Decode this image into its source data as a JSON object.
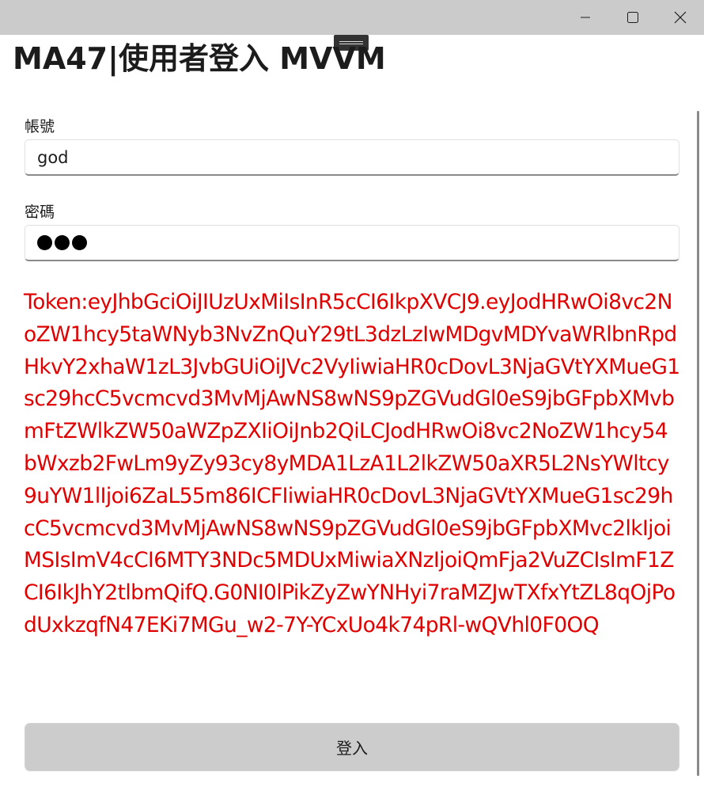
{
  "window": {
    "minimize_icon": "minimize-icon",
    "maximize_icon": "maximize-icon",
    "close_icon": "close-icon"
  },
  "page": {
    "title": "MA47|使用者登入 MVVM"
  },
  "form": {
    "username_label": "帳號",
    "username_value": "god",
    "password_label": "密碼",
    "password_mask_count": 3
  },
  "token": {
    "text": "Token:eyJhbGciOiJIUzUxMiIsInR5cCI6IkpXVCJ9.eyJodHRwOi8vc2NoZW1hcy5taWNyb3NvZnQuY29tL3dzLzIwMDgvMDYvaWRlbnRpdHkvY2xhaW1zL3JvbGUiOiJVc2VyIiwiaHR0cDovL3NjaGVtYXMueG1sc29hcC5vcmcvd3MvMjAwNS8wNS9pZGVudGl0eS9jbGFpbXMvbmFtZWlkZW50aWZpZXIiOiJnb2QiLCJodHRwOi8vc2NoZW1hcy54bWxzb2FwLm9yZy93cy8yMDA1LzA1L2lkZW50aXR5L2NsYWltcy9uYW1lIjoi6ZaL55m86ICFIiwiaHR0cDovL3NjaGVtYXMueG1sc29hcC5vcmcvd3MvMjAwNS8wNS9pZGVudGl0eS9jbGFpbXMvc2lkIjoiMSIsImV4cCI6MTY3NDc5MDUxMiwiaXNzIjoiQmFja2VuZCIsImF1ZCI6IkJhY2tlbmQifQ.G0NI0lPikZyZwYNHyi7raMZJwTXfxYtZL8qOjPodUxkzqfN47EKi7MGu_w2-7Y-YCxUo4k74pRl-wQVhl0F0OQ",
    "color": "#e00000"
  },
  "actions": {
    "login_label": "登入"
  }
}
